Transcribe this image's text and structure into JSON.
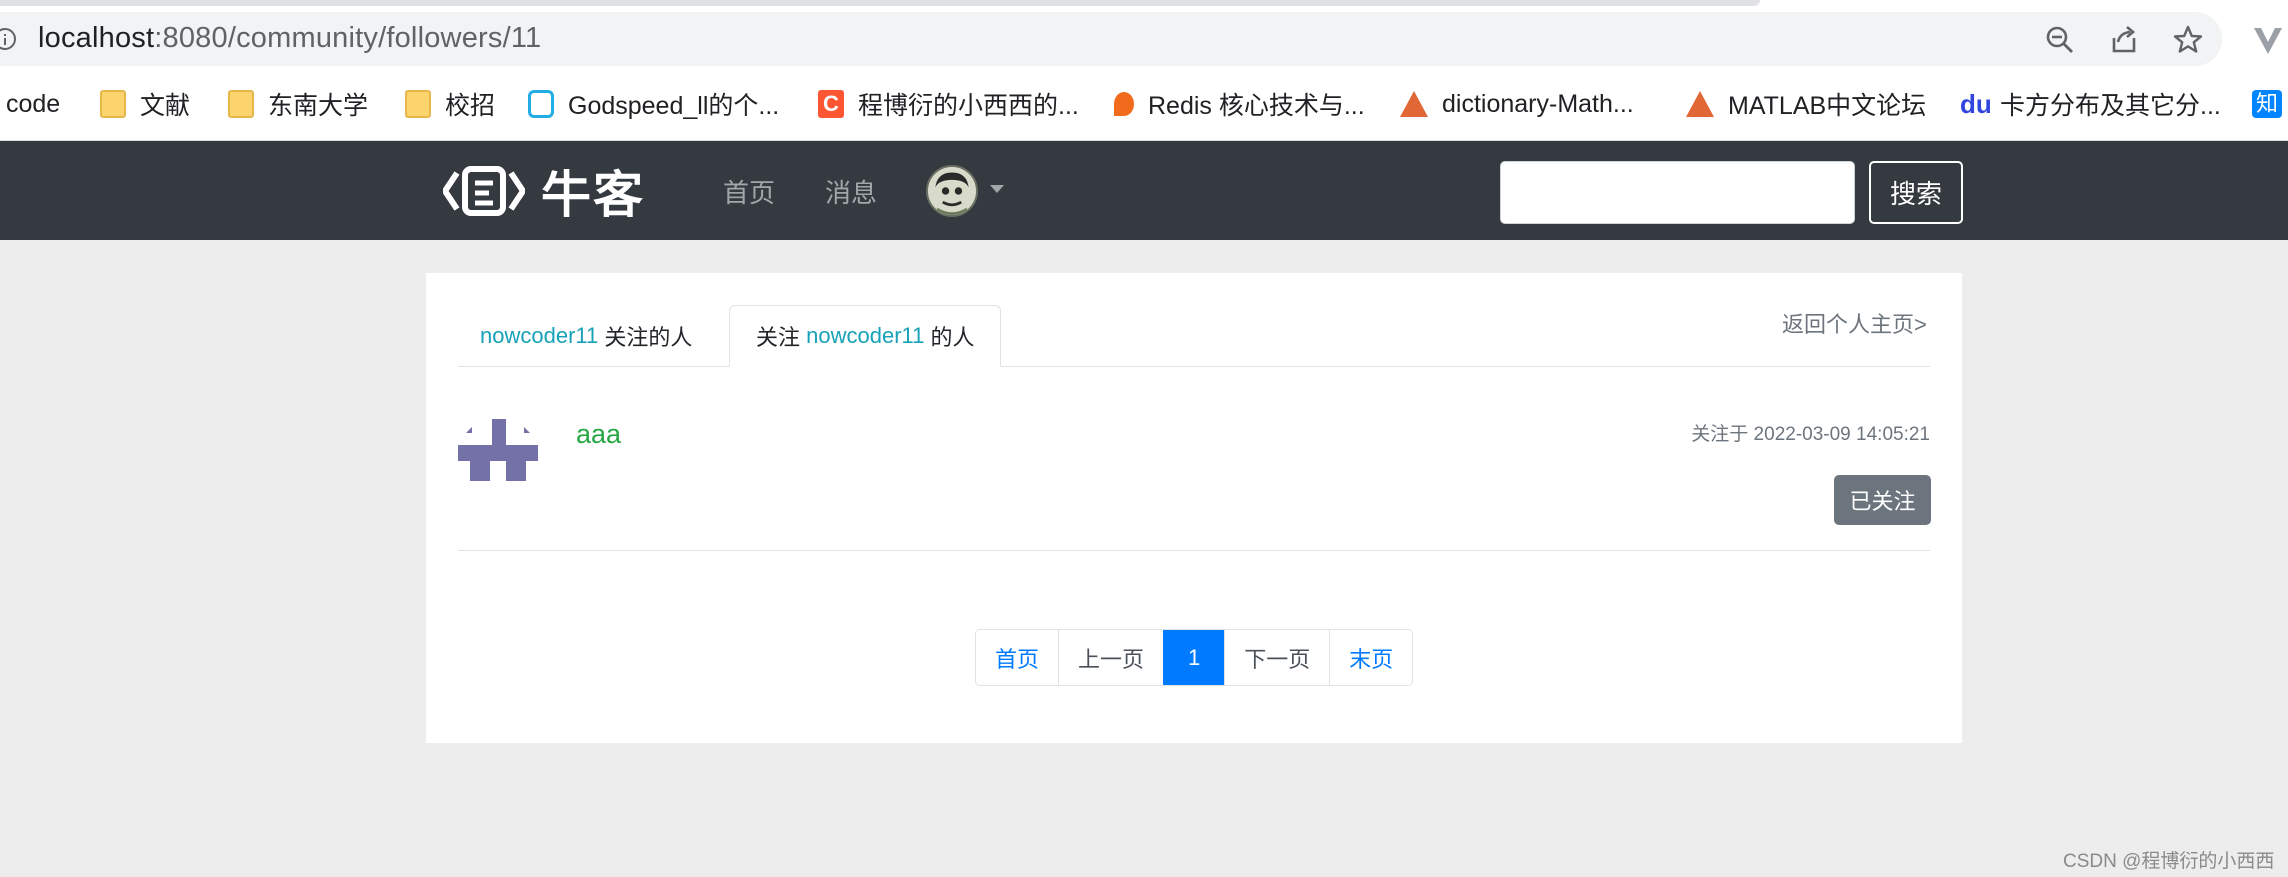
{
  "browser": {
    "url_host": "localhost",
    "url_rest": ":8080/community/followers/11",
    "bookmarks": [
      {
        "label": "code",
        "icon": "none"
      },
      {
        "label": "文献",
        "icon": "folder-icon"
      },
      {
        "label": "东南大学",
        "icon": "folder-icon"
      },
      {
        "label": "校招",
        "icon": "folder-icon"
      },
      {
        "label": "Godspeed_ll的个...",
        "icon": "bilibili-icon"
      },
      {
        "label": "程博衍的小西西的...",
        "icon": "csdn-icon"
      },
      {
        "label": "Redis 核心技术与...",
        "icon": "redis-icon"
      },
      {
        "label": "dictionary-Math...",
        "icon": "matlab-icon"
      },
      {
        "label": "MATLAB中文论坛",
        "icon": "matlab-icon"
      },
      {
        "label": "卡方分布及其它分...",
        "icon": "baidu-icon"
      },
      {
        "label": "知",
        "icon": "zhihu-icon"
      }
    ],
    "csdn_glyph": "C",
    "baidu_glyph": "du"
  },
  "navbar": {
    "brand": "牛客",
    "links": [
      "首页",
      "消息"
    ],
    "search_value": "",
    "search_button": "搜索"
  },
  "tabs": {
    "tab1_user": "nowcoder11",
    "tab1_suffix": " 关注的人",
    "tab2_prefix": "关注 ",
    "tab2_user": "nowcoder11",
    "tab2_suffix": " 的人",
    "back_link": "返回个人主页>"
  },
  "follower": {
    "name": "aaa",
    "time": "关注于 2022-03-09 14:05:21",
    "button": "已关注"
  },
  "pagination": {
    "first": "首页",
    "prev": "上一页",
    "current": "1",
    "next": "下一页",
    "last": "末页"
  },
  "watermark": "CSDN @程博衍的小西西",
  "colors": {
    "navbar_bg": "#343a40",
    "primary": "#007bff",
    "teal": "#17a2b8",
    "green": "#28a745",
    "secondary": "#6c757d",
    "avatar_purple": "#7470a8"
  }
}
